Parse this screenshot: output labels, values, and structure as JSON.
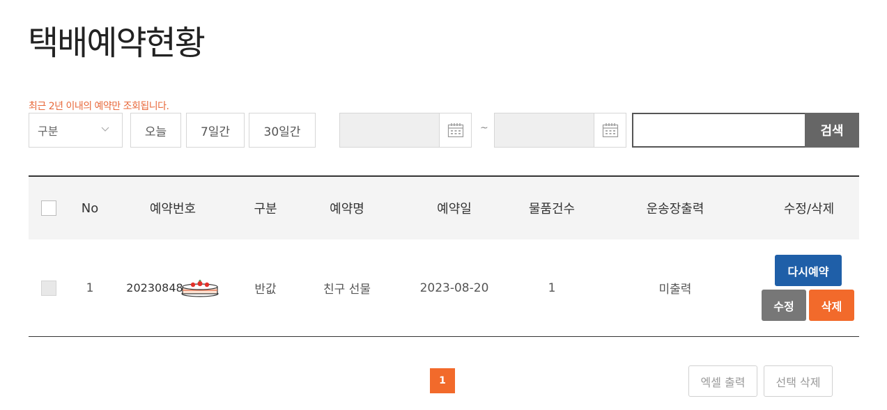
{
  "title": "택배예약현황",
  "notice": "최근 2년 이내의 예약만 조회됩니다.",
  "filter": {
    "type_select": "구분",
    "period_buttons": [
      "오늘",
      "7일간",
      "30일간"
    ],
    "date_separator": "~",
    "search_button": "검색"
  },
  "table": {
    "headers": [
      "No",
      "예약번호",
      "구분",
      "예약명",
      "예약일",
      "물품건수",
      "운송장출력",
      "수정/삭제"
    ],
    "rows": [
      {
        "no": "1",
        "reservation_number": "20230848",
        "type": "반값",
        "name": "친구 선물",
        "date": "2023-08-20",
        "item_count": "1",
        "waybill": "미출력",
        "rebook_label": "다시예약",
        "edit_label": "수정",
        "delete_label": "삭제"
      }
    ]
  },
  "pagination": {
    "current": "1"
  },
  "actions": {
    "excel_label": "엑셀 출력",
    "delete_selected_label": "선택 삭제"
  },
  "colors": {
    "accent": "#f26a2b",
    "primary_blue": "#1f5fa8",
    "notice": "#e8683a"
  }
}
